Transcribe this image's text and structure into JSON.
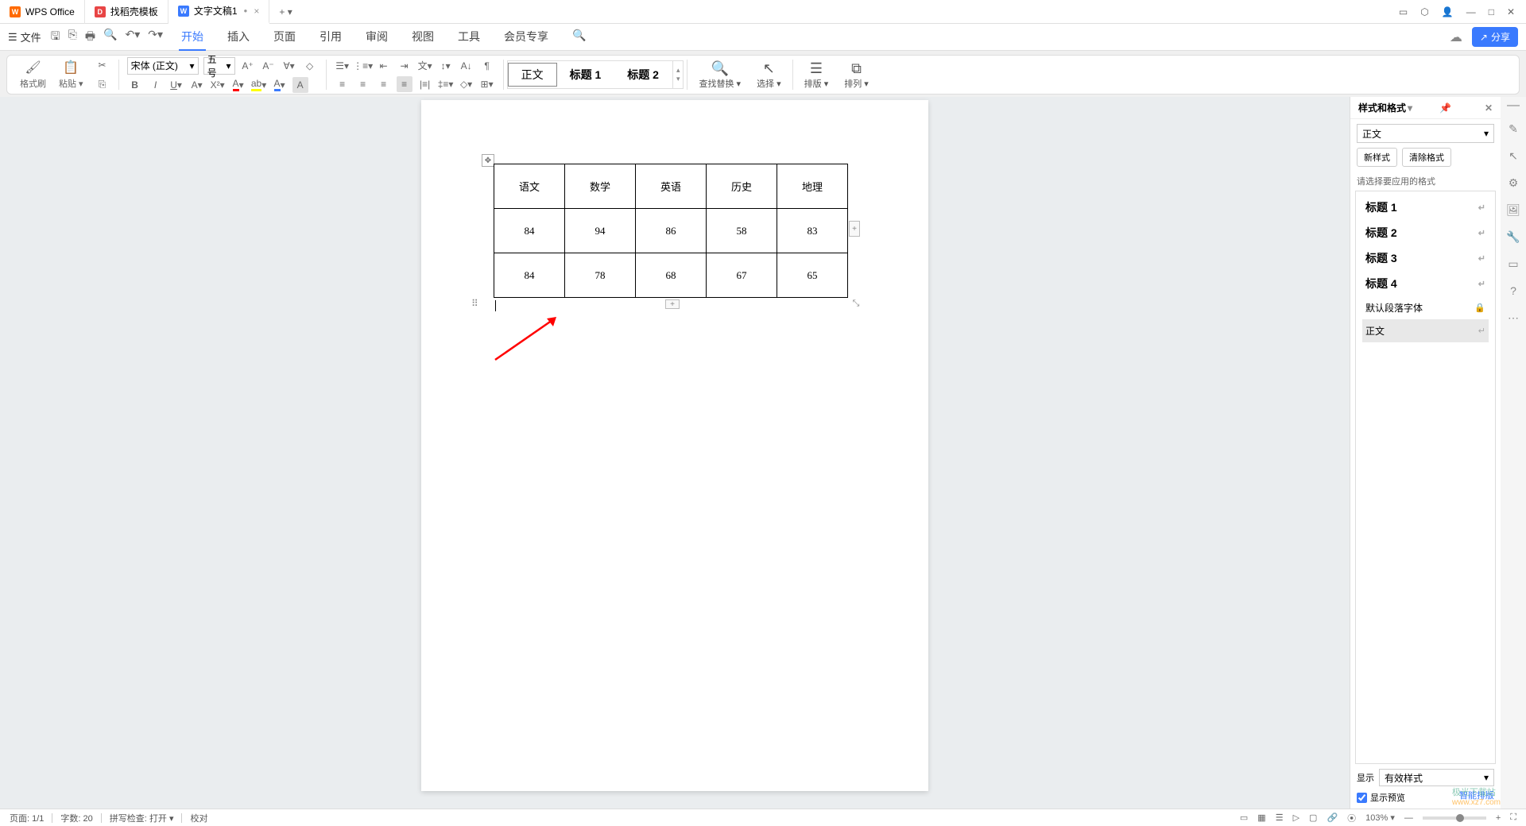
{
  "tabs": [
    {
      "icon": "W",
      "iconColor": "orange",
      "label": "WPS Office"
    },
    {
      "icon": "D",
      "iconColor": "red",
      "label": "找稻壳模板"
    },
    {
      "icon": "W",
      "iconColor": "blue",
      "label": "文字文稿1",
      "closable": true
    }
  ],
  "menubar": {
    "file": "文件",
    "quickIcons": [
      "save",
      "new",
      "print",
      "preview",
      "undo",
      "redo"
    ],
    "tabs": [
      "开始",
      "插入",
      "页面",
      "引用",
      "审阅",
      "视图",
      "工具",
      "会员专享"
    ],
    "activeTab": "开始",
    "shareLabel": "分享"
  },
  "ribbon": {
    "formatPainter": "格式刷",
    "paste": "粘贴",
    "fontName": "宋体 (正文)",
    "fontSize": "五号",
    "styles": [
      "正文",
      "标题 1",
      "标题 2"
    ],
    "findReplace": "查找替换",
    "select": "选择",
    "layout": "排版",
    "arrange": "排列"
  },
  "document": {
    "table": {
      "headers": [
        "语文",
        "数学",
        "英语",
        "历史",
        "地理"
      ],
      "rows": [
        [
          "84",
          "94",
          "86",
          "58",
          "83"
        ],
        [
          "84",
          "78",
          "68",
          "67",
          "65"
        ]
      ]
    }
  },
  "stylesPanel": {
    "title": "样式和格式",
    "current": "正文",
    "newStyleBtn": "新样式",
    "clearFormatBtn": "清除格式",
    "selectLabel": "请选择要应用的格式",
    "items": [
      {
        "label": "标题 1",
        "bold": true
      },
      {
        "label": "标题 2",
        "bold": true
      },
      {
        "label": "标题 3",
        "bold": true
      },
      {
        "label": "标题 4",
        "bold": true
      },
      {
        "label": "默认段落字体",
        "bold": false,
        "locked": true
      },
      {
        "label": "正文",
        "bold": false,
        "active": true
      }
    ],
    "showLabel": "显示",
    "showValue": "有效样式",
    "previewCheck": "显示预览",
    "smartLayout": "智能排版"
  },
  "statusbar": {
    "page": "页面: 1/1",
    "wordCount": "字数: 20",
    "spellCheck": "拼写检查: 打开",
    "proof": "校对",
    "zoom": "103%"
  },
  "watermark": {
    "line1": "极光下载站",
    "line2": "www.xz7.com"
  }
}
